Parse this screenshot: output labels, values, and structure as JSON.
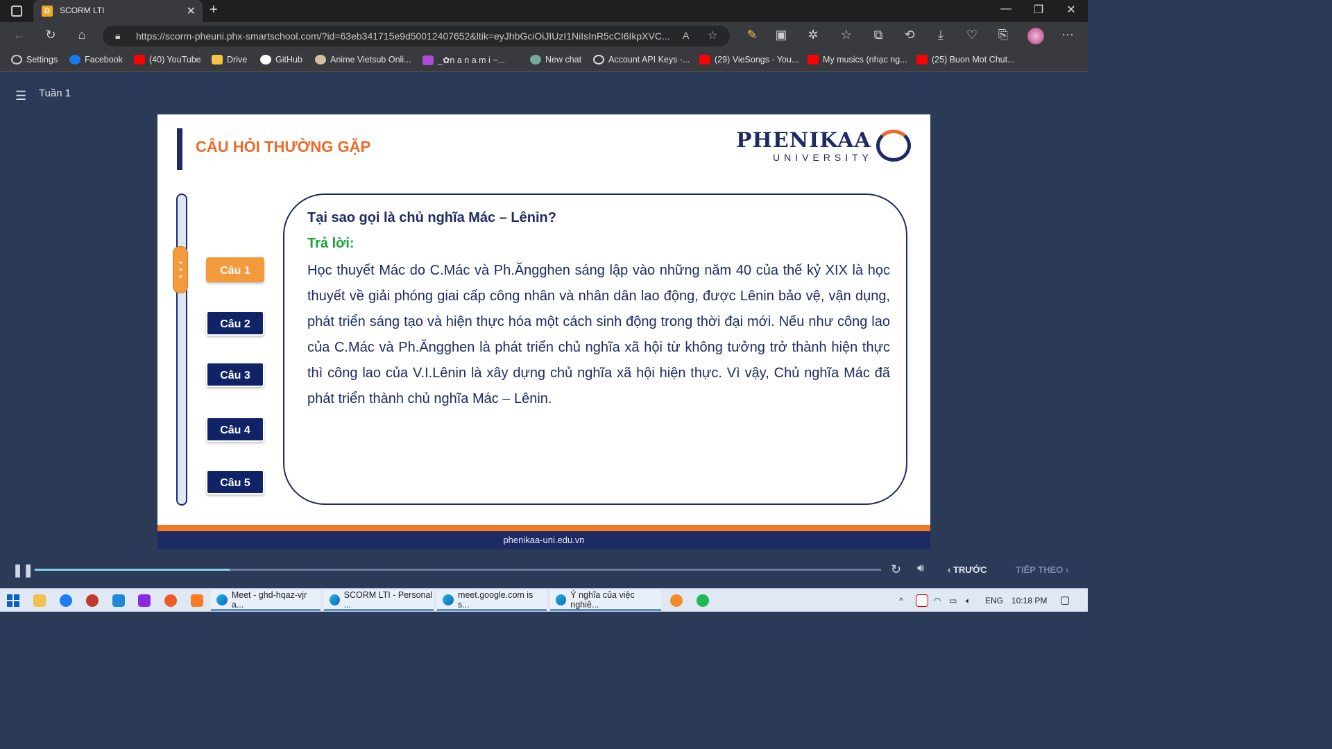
{
  "browser": {
    "tab_title": "SCORM LTI",
    "tab_favicon_letter": "D",
    "url": "https://scorm-pheuni.phx-smartschool.com/?id=63eb341715e9d50012407652&ltik=eyJhbGciOiJIUzI1NiIsInR5cCI6IkpXVC...",
    "bookmarks": [
      {
        "label": "Settings",
        "icon": "gear-icon",
        "color": "#cccccc"
      },
      {
        "label": "Facebook",
        "icon": "facebook-icon",
        "color": "#1877f2"
      },
      {
        "label": "(40) YouTube",
        "icon": "youtube-icon",
        "color": "#ff0000"
      },
      {
        "label": "Drive",
        "icon": "folder-icon",
        "color": "#f6c445"
      },
      {
        "label": "GitHub",
        "icon": "github-icon",
        "color": "#ffffff"
      },
      {
        "label": "Anime Vietsub Onli...",
        "icon": "anime-icon",
        "color": "#d0c0a0"
      },
      {
        "label": "_✿n a n a m i ~...",
        "icon": "flower-icon",
        "color": "#b04bd8"
      },
      {
        "label": "New chat",
        "icon": "chatgpt-icon",
        "color": "#74aa9c"
      },
      {
        "label": "Account API Keys -...",
        "icon": "openai-icon",
        "color": "#dddddd"
      },
      {
        "label": "(29) VieSongs - You...",
        "icon": "youtube-icon",
        "color": "#ff0000"
      },
      {
        "label": "My musics (nhạc ng...",
        "icon": "youtube-icon",
        "color": "#ff0000"
      },
      {
        "label": "(25) Buon Mot Chut...",
        "icon": "youtube-icon",
        "color": "#ff0000"
      }
    ]
  },
  "app": {
    "week_label": "Tuần 1"
  },
  "slide": {
    "title": "CÂU HỎI THƯỜNG GẶP",
    "logo_text": "PHENIKAA",
    "logo_sub": "UNIVERSITY",
    "questions": [
      "Câu 1",
      "Câu 2",
      "Câu 3",
      "Câu 4",
      "Câu 5"
    ],
    "active_question": 1,
    "question_title": "Tại sao gọi là chủ nghĩa Mác – Lênin?",
    "answer_label": "Trả lời:",
    "answer_text": "Học thuyết Mác do C.Mác và Ph.Ăngghen sáng lập vào những năm 40 của thế kỷ XIX là học thuyết về giải phóng giai cấp công nhân và nhân dân lao động, được Lênin bảo vệ, vận dụng, phát triển sáng tạo và hiện thực hóa một cách sinh động trong thời đại mới. Nếu như công lao của C.Mác và Ph.Ăngghen là phát triển chủ nghĩa xã hội từ không tưởng trở thành hiện thực thì công lao của V.I.Lênin là xây dựng chủ nghĩa xã hội hiện thực. Vì vậy, Chủ nghĩa Mác đã phát triển thành chủ nghĩa Mác – Lênin.",
    "footer": "phenikaa-uni.edu.vn",
    "colors": {
      "accent": "#ec6a2a",
      "navy": "#1d2a64",
      "green": "#17a33a"
    }
  },
  "player": {
    "progress_fraction": 0.23,
    "prev_label": "TRƯỚC",
    "next_label": "TIẾP THEO"
  },
  "taskbar": {
    "apps": [
      {
        "label": "Meet - ghd-hqaz-vjr a..."
      },
      {
        "label": "SCORM LTI - Personal ..."
      },
      {
        "label": "meet.google.com is s..."
      },
      {
        "label": "Ý nghĩa của việc nghiê..."
      }
    ],
    "language": "ENG",
    "time": "10:18 PM"
  }
}
